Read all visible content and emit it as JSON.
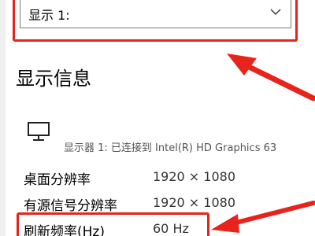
{
  "display_select": {
    "value": "显示 1:"
  },
  "section": {
    "title": "显示信息"
  },
  "monitor": {
    "icon": "monitor-icon",
    "connection_text": "显示器 1: 已连接到 Intel(R) HD Graphics 63"
  },
  "rows": [
    {
      "label": "桌面分辨率",
      "value": "1920 × 1080"
    },
    {
      "label": "有源信号分辨率",
      "value": "1920 × 1080"
    },
    {
      "label": "刷新频率(Hz)",
      "value": "60 Hz"
    }
  ],
  "colors": {
    "annotation_red": "#e8231b"
  }
}
